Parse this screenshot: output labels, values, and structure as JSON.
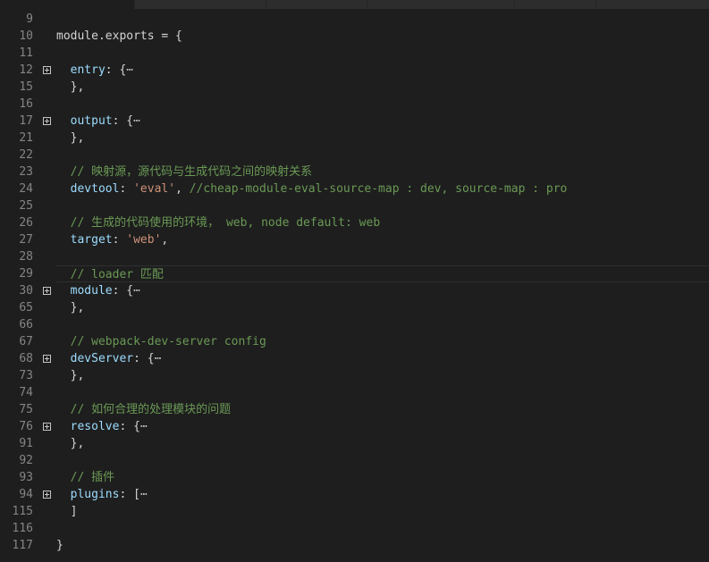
{
  "editor": {
    "lines": [
      {
        "num": "9",
        "code": ""
      },
      {
        "num": "10",
        "code": "module.exports = {"
      },
      {
        "num": "11",
        "code": ""
      },
      {
        "num": "12",
        "key": "entry",
        "rest": ": {",
        "ellipsis": "⋯",
        "fold": true
      },
      {
        "num": "15",
        "code": "  },"
      },
      {
        "num": "16",
        "code": ""
      },
      {
        "num": "17",
        "key": "output",
        "rest": ": {",
        "ellipsis": "⋯",
        "fold": true
      },
      {
        "num": "21",
        "code": "  },"
      },
      {
        "num": "22",
        "code": ""
      },
      {
        "num": "23",
        "comment": "  // 映射源，源代码与生成代码之间的映射关系"
      },
      {
        "num": "24",
        "key": "devtool",
        "rest": ": ",
        "string": "'eval'",
        "after": ", ",
        "comment2": "//cheap-module-eval-source-map : dev, source-map : pro"
      },
      {
        "num": "25",
        "code": ""
      },
      {
        "num": "26",
        "comment": "  // 生成的代码使用的环境， web, node default: web"
      },
      {
        "num": "27",
        "key": "target",
        "rest": ": ",
        "string": "'web'",
        "after": ","
      },
      {
        "num": "28",
        "code": ""
      },
      {
        "num": "29",
        "comment": "  // loader 匹配",
        "highlight": true
      },
      {
        "num": "30",
        "key": "module",
        "rest": ": {",
        "ellipsis": "⋯",
        "fold": true
      },
      {
        "num": "65",
        "code": "  },"
      },
      {
        "num": "66",
        "code": ""
      },
      {
        "num": "67",
        "comment": "  // webpack-dev-server config"
      },
      {
        "num": "68",
        "key": "devServer",
        "rest": ": {",
        "ellipsis": "⋯",
        "fold": true
      },
      {
        "num": "73",
        "code": "  },"
      },
      {
        "num": "74",
        "code": ""
      },
      {
        "num": "75",
        "comment": "  // 如何合理的处理模块的问题"
      },
      {
        "num": "76",
        "key": "resolve",
        "rest": ": {",
        "ellipsis": "⋯",
        "fold": true
      },
      {
        "num": "91",
        "code": "  },"
      },
      {
        "num": "92",
        "code": ""
      },
      {
        "num": "93",
        "comment": "  // 插件"
      },
      {
        "num": "94",
        "key": "plugins",
        "rest": ": [",
        "ellipsis": "⋯",
        "fold": true
      },
      {
        "num": "115",
        "code": "  ]"
      },
      {
        "num": "116",
        "code": ""
      },
      {
        "num": "117",
        "code": "}"
      }
    ]
  },
  "colors": {
    "background": "#1e1e1e",
    "line_number": "#858585",
    "key": "#9cdcfe",
    "string": "#ce9178",
    "comment": "#6a9955",
    "text": "#d4d4d4"
  }
}
